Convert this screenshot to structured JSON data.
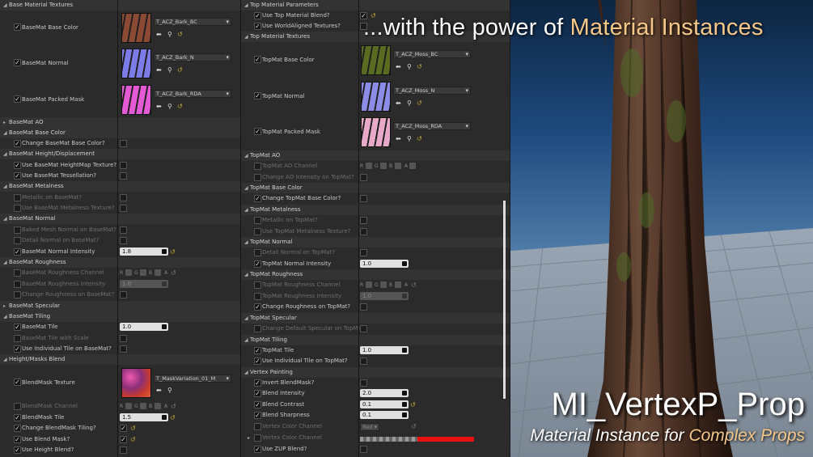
{
  "overlay": {
    "headline_prefix": "...with the power of ",
    "headline_accent": "Material Instances",
    "title": "MI_VertexP_Prop",
    "subtitle_prefix": "Material Instance for ",
    "subtitle_accent": "Complex Props",
    "accent_color": "#f5c88a"
  },
  "left": {
    "textures_header": "Base Material Textures",
    "textures": [
      {
        "label": "BaseMat Base Color",
        "asset": "T_ACZ_Bark_BC",
        "thumb": "#8a4a33"
      },
      {
        "label": "BaseMat Normal",
        "asset": "T_ACZ_Bark_N",
        "thumb": "#7b7ce8"
      },
      {
        "label": "BaseMat Packed Mask",
        "asset": "T_ACZ_Bark_RDA",
        "thumb": "#e45ad4"
      }
    ],
    "ao": "BaseMat AO",
    "base_color": "BaseMat Base Color",
    "change_base_color": "Change BaseMat Base Color?",
    "height": "BaseMat Height/Displacement",
    "use_heightmap": "Use BaseMat HeightMap Texture?",
    "use_tess": "Use BaseMat Tessellation?",
    "metalness": "BaseMat Metalness",
    "metallic": "Metallic on BaseMat?",
    "use_metal_tex": "Use BaseMat Metalness Texture?",
    "normal": "BaseMat Normal",
    "baked_mesh": "Baked Mesh Normal on BaseMat?",
    "detail_normal": "Detail Normal on BaseMat?",
    "normal_intensity": "BaseMat Normal Intensity",
    "normal_intensity_val": "1.8",
    "roughness": "BaseMat Roughness",
    "rough_channel": "BaseMat Roughness Channel",
    "rough_intensity": "BaseMat Roughness Intensity",
    "rough_intensity_val": "1.0",
    "change_rough": "Change Roughness on BaseMat?",
    "specular": "BaseMat Specular",
    "tiling": "BaseMat Tiling",
    "tile": "BaseMat Tile",
    "tile_val": "1.0",
    "tile_scale": "BaseMat Tile with Scale",
    "individual_tile": "Use Individual Tile on BaseMat?",
    "blend_header": "Height/Masks Blend",
    "blendmask_tex": "BlendMask Texture",
    "blendmask_asset": "T_MaskVariation_01_M",
    "blendmask_channel": "BlendMask Channel",
    "blendmask_tile": "BlendMask Tile",
    "blendmask_tile_val": "1.5",
    "change_blend_tiling": "Change BlendMask Tiling?",
    "use_blend_mask": "Use Blend Mask?",
    "use_height_blend": "Use Height Blend?"
  },
  "right": {
    "params_header": "Top Material Parameters",
    "use_topmat_blend": "Use Top Material Blend?",
    "use_world_aligned": "Use WorldAligned Textures?",
    "textures_header": "Top Material Textures",
    "textures": [
      {
        "label": "TopMat Base Color",
        "asset": "T_ACZ_Moss_BC",
        "thumb": "#5a6b22"
      },
      {
        "label": "TopMat Normal",
        "asset": "T_ACZ_Moss_N",
        "thumb": "#8c8ce6"
      },
      {
        "label": "TopMat Packed Mask",
        "asset": "T_ACZ_Moss_RDA",
        "thumb": "#e8a8c8"
      }
    ],
    "ao": "TopMat AO",
    "ao_channel": "TopMat AO Channel",
    "change_ao": "Change AO Intensity on TopMat?",
    "base_color": "TopMat Base Color",
    "change_base_color": "Change TopMat Base Color?",
    "metalness": "TopMat Metalness",
    "metallic": "Metallic on TopMat?",
    "use_metal_tex": "Use TopMat Metalness Texture?",
    "normal": "TopMat Normal",
    "detail_normal": "Detail Normal on TopMat?",
    "normal_intensity": "TopMat Normal Intensity",
    "normal_intensity_val": "1.0",
    "roughness": "TopMat Roughness",
    "rough_channel": "TopMat Roughness Channel",
    "rough_intensity": "TopMat Roughness Intensity",
    "rough_intensity_val": "1.0",
    "change_rough": "Change Roughness on TopMat?",
    "specular": "TopMat Specular",
    "change_spec": "Change Default Specular on TopMat?",
    "tiling": "TopMat Tiling",
    "tile": "TopMat Tile",
    "tile_val": "1.0",
    "individual_tile": "Use Individual Tile on TopMat?",
    "vertex_header": "Vertex Painting",
    "invert_blend": "Invert BlendMask?",
    "blend_intensity": "Blend Intensity",
    "blend_intensity_val": "2.0",
    "blend_contrast": "Blend Contrast",
    "blend_contrast_val": "0.1",
    "blend_sharpness": "Blend Sharpness",
    "blend_sharpness_val": "0.1",
    "vc_channel": "Vertex Color Channel",
    "vc_channel_val": "Red",
    "vc_color": "Vertex Color Channel",
    "use_zup": "Use ZUP Blend?"
  },
  "channels": {
    "r": "R",
    "g": "G",
    "b": "B",
    "a": "A"
  }
}
